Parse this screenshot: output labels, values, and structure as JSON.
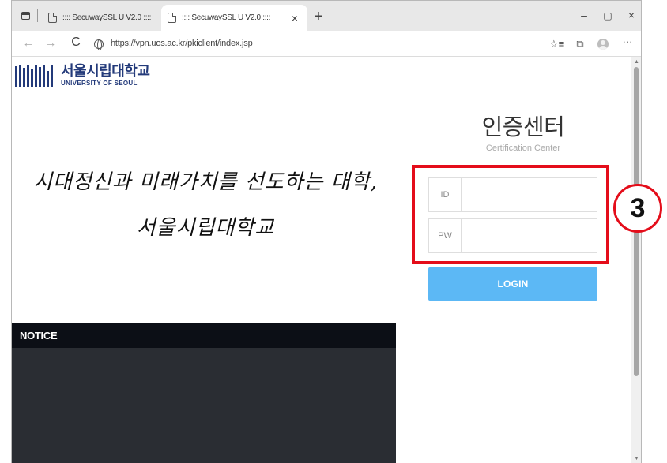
{
  "browser": {
    "tabs": [
      {
        "title": ":::: SecuwaySSL U V2.0 ::::",
        "active": false
      },
      {
        "title": ":::: SecuwaySSL U V2.0 ::::",
        "active": true
      }
    ],
    "new_tab": "+",
    "tab_close": "×",
    "window": {
      "minimize": "–",
      "maximize": "▢",
      "close": "×"
    },
    "nav": {
      "back": "←",
      "forward": "→",
      "reload": "C"
    },
    "url": "https://vpn.uos.ac.kr/pkiclient/index.jsp",
    "tools": {
      "favorites": "☆≡",
      "collections": "⧉",
      "more": "···"
    }
  },
  "page": {
    "logo": {
      "korean": "서울시립대학교",
      "english": "UNIVERSITY OF SEOUL"
    },
    "slogan": {
      "line1": "시대정신과 미래가치를 선도하는 대학,",
      "line2": "서울시립대학교"
    },
    "cert": {
      "title": "인증센터",
      "subtitle": "Certification Center"
    },
    "form": {
      "id_label": "ID",
      "id_value": "",
      "pw_label": "PW",
      "pw_value": "",
      "login_label": "LOGIN"
    },
    "notice": {
      "title": "NOTICE"
    }
  },
  "annotation": {
    "step": "3",
    "color": "#e40d1a"
  },
  "colors": {
    "login": "#5cb8f5",
    "brand": "#233a7a",
    "notice_header": "#0c0f16",
    "notice_body": "#2a2d33"
  }
}
